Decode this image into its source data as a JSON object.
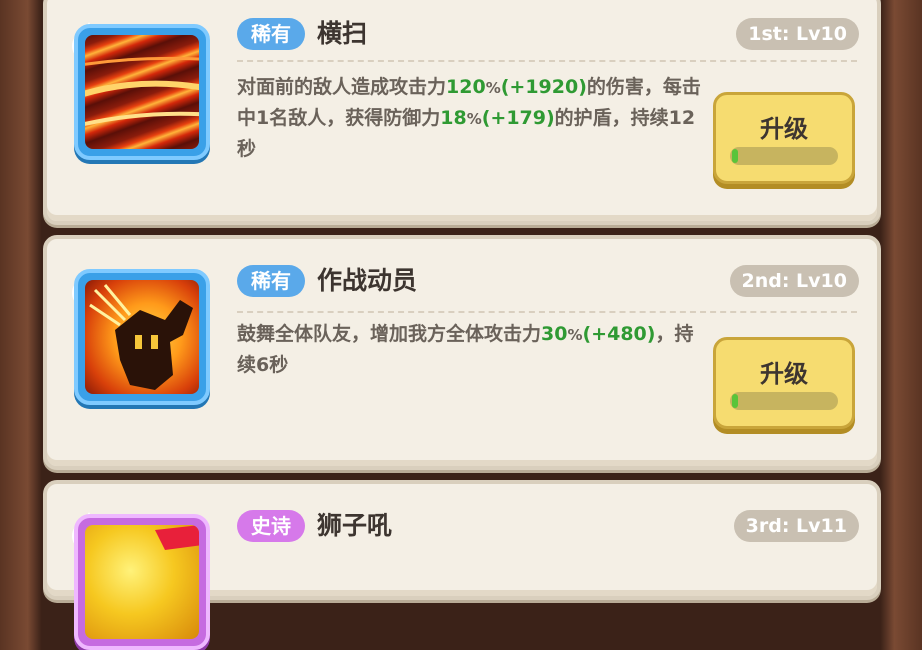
{
  "skills": [
    {
      "badge": "3",
      "rarity": "稀有",
      "name": "横扫",
      "level": "1st: Lv10",
      "desc_parts": [
        "对面前的敌人造成攻击力",
        "120",
        "%",
        "(+1920)",
        "的伤害，每击中1名敌人，获得防御力",
        "18",
        "%",
        "(+179)",
        "的护盾，持续12秒"
      ],
      "button": "升级",
      "progress": 0.04,
      "icon": "slash-icon"
    },
    {
      "badge": "3",
      "rarity": "稀有",
      "name": "作战动员",
      "level": "2nd: Lv10",
      "desc_parts": [
        "鼓舞全体队友，增加我方全体攻击力",
        "30",
        "%",
        "(+480)",
        "，持续6秒"
      ],
      "button": "升级",
      "progress": 0.04,
      "icon": "rally-icon"
    },
    {
      "badge": "2",
      "rarity": "史诗",
      "name": "狮子吼",
      "level": "3rd: Lv11",
      "icon": "lion-icon"
    }
  ],
  "colors": {
    "rare": "#5aa9ea",
    "epic": "#d679ea",
    "highlight": "#2f9a33",
    "button": "#f6dc70"
  }
}
